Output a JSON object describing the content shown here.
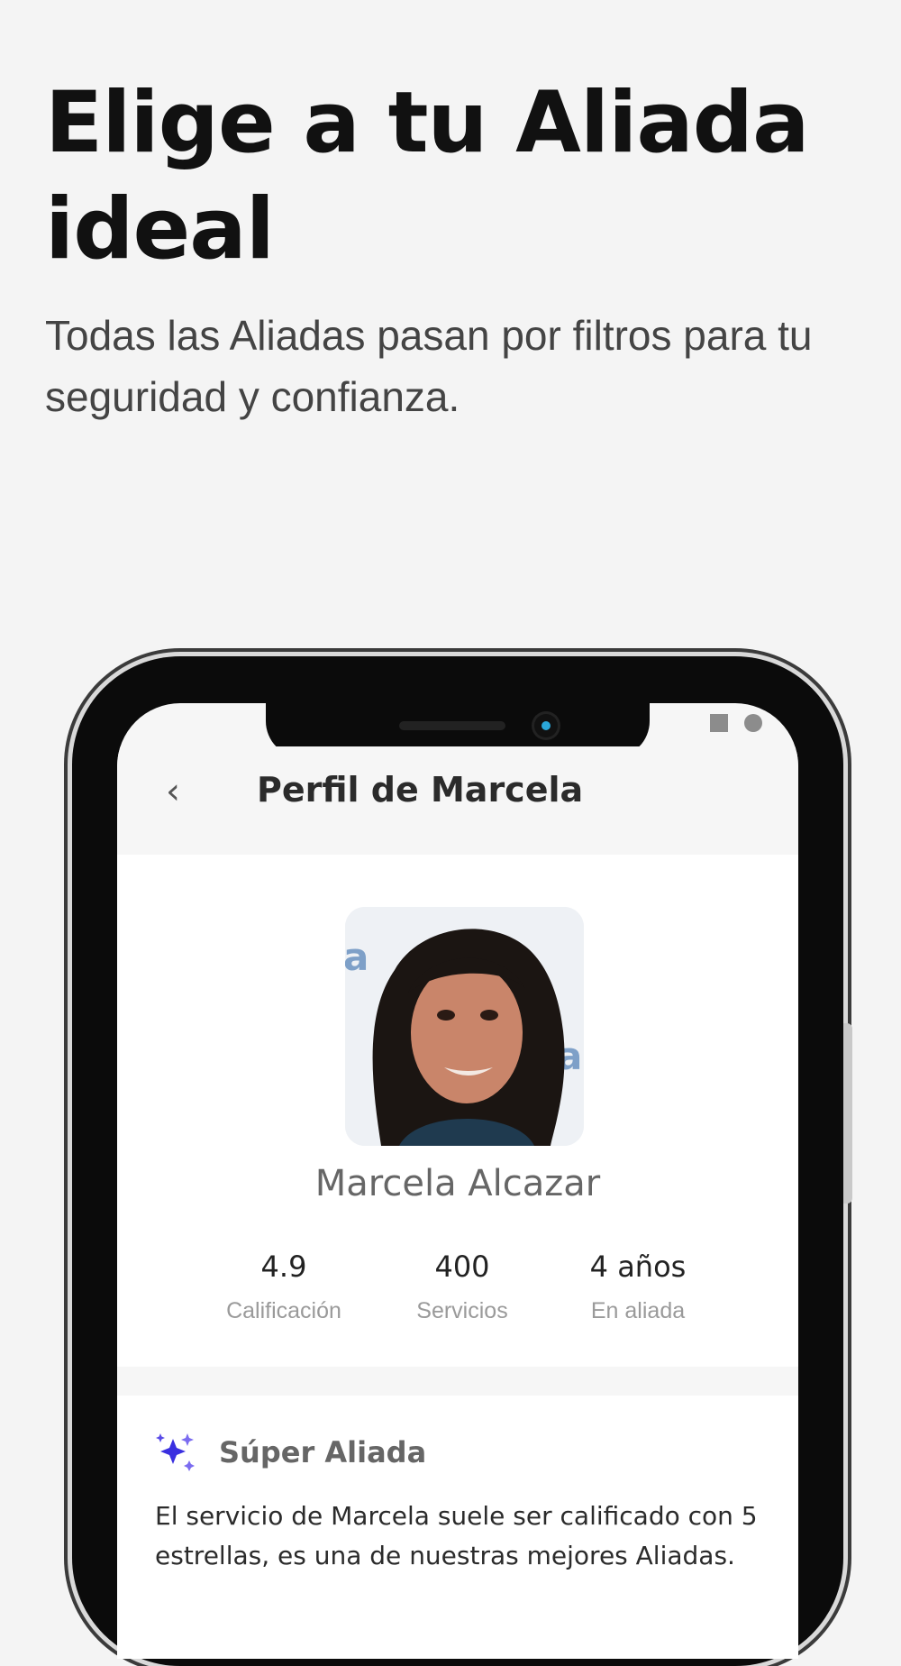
{
  "hero": {
    "title": "Elige a tu Aliada ideal",
    "subtitle": "Todas las Aliadas pasan por filtros para tu seguridad y confianza."
  },
  "app": {
    "screen_title": "Perfil de Marcela",
    "back_icon": "chevron-left-icon",
    "profile": {
      "name": "Marcela Alcazar",
      "stats": [
        {
          "value": "4.9",
          "label": "Calificación"
        },
        {
          "value": "400",
          "label": "Servicios"
        },
        {
          "value": "4 años",
          "label": "En aliada"
        }
      ]
    },
    "badge": {
      "icon": "sparkle-icon",
      "title": "Súper Aliada",
      "description": "El servicio de Marcela suele ser calificado con 5 estrellas, es una de nuestras mejores Aliadas."
    }
  },
  "colors": {
    "background": "#f4f4f4",
    "sparkle_accent": "#3a2fe0",
    "camera_lens": "#2aa7d9"
  }
}
